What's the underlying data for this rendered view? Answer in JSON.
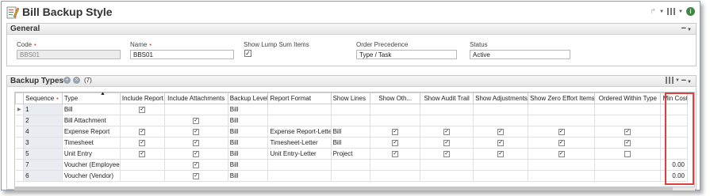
{
  "window": {
    "title": "Bill Backup Style"
  },
  "general": {
    "title": "General",
    "code_label": "Code",
    "code_value": "BBS01",
    "name_label": "Name",
    "name_value": "BBS01",
    "lump_label": "Show Lump Sum Items",
    "lump_checked": "✓",
    "order_label": "Order Precedence",
    "order_value": "Type / Task",
    "status_label": "Status",
    "status_value": "Active",
    "required_mark": "•",
    "collapse_label": "−"
  },
  "backup_types": {
    "title": "Backup Types",
    "count": "(7)",
    "collapse_label": "−",
    "columns": [
      "Sequence",
      "Type",
      "Include Report",
      "Include Attachments",
      "Backup Level",
      "Report Format",
      "Show Lines",
      "Show Oth...",
      "Show Audit Trail",
      "Show Adjustments",
      "Show Zero Effort Items",
      "Ordered Within Type",
      "Min Cost"
    ],
    "required_mark": "•",
    "rows": [
      [
        "1",
        "Bill",
        "✓",
        "",
        "Bill",
        "",
        "",
        "",
        "",
        "",
        "",
        "",
        ""
      ],
      [
        "2",
        "Bill Attachment",
        "",
        "✓",
        "Bill",
        "",
        "",
        "",
        "",
        "",
        "",
        "",
        ""
      ],
      [
        "4",
        "Expense Report",
        "✓",
        "✓",
        "Bill",
        "Expense Report-Letter",
        "Bill",
        "✓",
        "✓",
        "✓",
        "✓",
        "✓",
        ""
      ],
      [
        "3",
        "Timesheet",
        "✓",
        "✓",
        "Bill",
        "Timesheet-Letter",
        "Bill",
        "✓",
        "✓",
        "✓",
        "✓",
        "✓",
        ""
      ],
      [
        "5",
        "Unit Entry",
        "✓",
        "✓",
        "Bill",
        "Unit Entry-Letter",
        "Project",
        "✓",
        "✓",
        "✓",
        "✓",
        "",
        ""
      ],
      [
        "7",
        "Voucher (Employee)",
        "",
        "✓",
        "Bill",
        "",
        "",
        "",
        "",
        "",
        "",
        "",
        "0.00"
      ],
      [
        "6",
        "Voucher (Vendor)",
        "",
        "✓",
        "Bill",
        "",
        "",
        "",
        "",
        "",
        "",
        "",
        "0.00"
      ]
    ],
    "checkbox_columns": [
      2,
      3,
      7,
      8,
      9,
      10,
      11
    ],
    "empty_checkbox_cells": [
      [
        4,
        11
      ]
    ]
  },
  "colors": {
    "highlight": "#e23d3d",
    "info": "#3b8a3e",
    "sequence_bg": "#e9edf2"
  }
}
